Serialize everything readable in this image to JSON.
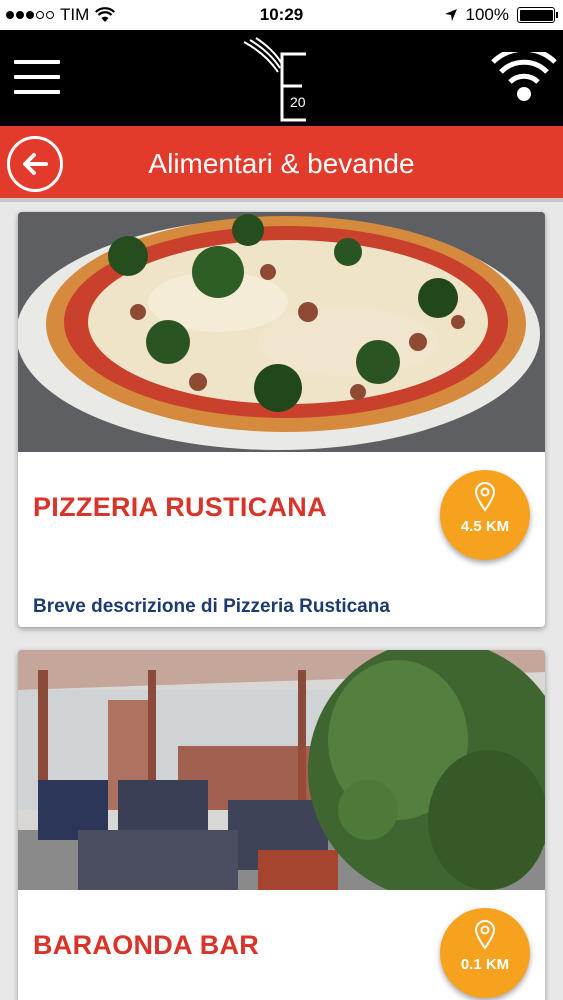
{
  "status_bar": {
    "carrier": "TIM",
    "time": "10:29",
    "battery": "100%",
    "signal_icon": "signal-dots-icon",
    "wifi_icon": "wifi-icon",
    "location_icon": "location-arrow-icon",
    "battery_level": 1.0
  },
  "header": {
    "logo_number": "20",
    "menu_icon": "hamburger-menu-icon",
    "wifi_icon": "wifi-icon"
  },
  "titlebar": {
    "title": "Alimentari & bevande",
    "back_icon": "back-arrow-icon"
  },
  "listings": [
    {
      "name": "PIZZERIA RUSTICANA",
      "distance": "4.5 KM",
      "description": "Breve descrizione di Pizzeria Rusticana",
      "photo": "pizza-photo"
    },
    {
      "name": "BARAONDA BAR",
      "distance": "0.1 KM",
      "description": "",
      "photo": "bar-terrace-photo"
    }
  ],
  "colors": {
    "header_bg": "#000000",
    "title_bar": "#e23b2b",
    "name_red": "#d9342a",
    "distance_badge": "#f6a21e",
    "description_blue": "#1e3a6e"
  }
}
